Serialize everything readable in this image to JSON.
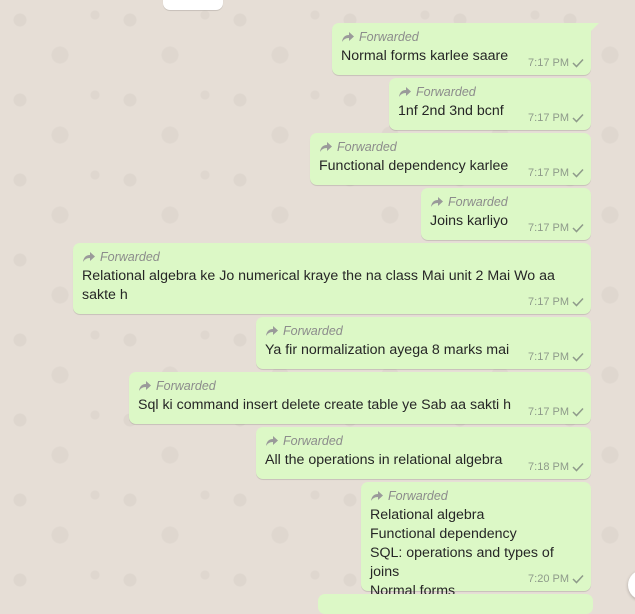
{
  "chat": {
    "messages": [
      {
        "forwarded_label": "Forwarded",
        "text": "Normal forms karlee saare",
        "time": "7:17 PM"
      },
      {
        "forwarded_label": "Forwarded",
        "text": "1nf 2nd 3nd bcnf",
        "time": "7:17 PM"
      },
      {
        "forwarded_label": "Forwarded",
        "text": "Functional dependency karlee",
        "time": "7:17 PM"
      },
      {
        "forwarded_label": "Forwarded",
        "text": "Joins karliyo",
        "time": "7:17 PM"
      },
      {
        "forwarded_label": "Forwarded",
        "text": "Relational algebra ke Jo numerical kraye the na class Mai unit 2 Mai Wo aa sakte h",
        "time": "7:17 PM"
      },
      {
        "forwarded_label": "Forwarded",
        "text": "Ya fir normalization ayega 8 marks mai",
        "time": "7:17 PM"
      },
      {
        "forwarded_label": "Forwarded",
        "text": "Sql ki command insert delete create table ye Sab aa sakti h",
        "time": "7:17 PM"
      },
      {
        "forwarded_label": "Forwarded",
        "text": "All the operations in relational algebra",
        "time": "7:18 PM"
      },
      {
        "forwarded_label": "Forwarded",
        "text": "Relational algebra\nFunctional dependency\nSQL: operations and types of joins\nNormal forms",
        "time": "7:20 PM"
      }
    ]
  },
  "colors": {
    "outgoing_bubble": "#dcf8c6",
    "chat_background": "#e6ded6",
    "meta_text": "#8e9a8a"
  },
  "icons": {
    "forward": "forward-arrow-icon",
    "delivered": "single-check-icon"
  }
}
